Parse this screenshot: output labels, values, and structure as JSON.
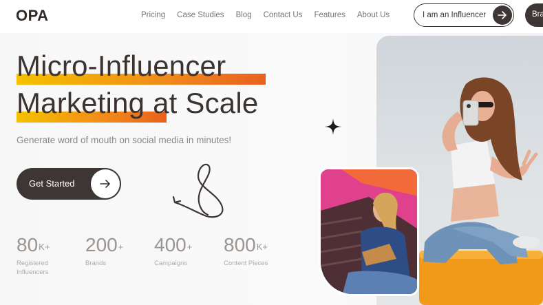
{
  "nav": {
    "logo": "OPA",
    "links": [
      "Pricing",
      "Case Studies",
      "Blog",
      "Contact Us",
      "Features",
      "About Us"
    ],
    "influencer_button": "I am an Influencer",
    "brand_button": "Bra"
  },
  "hero": {
    "title_line1": "Micro-Influencer",
    "title_line2": "Marketing at Scale",
    "subtitle": "Generate word of mouth on social media in minutes!",
    "cta_label": "Get Started"
  },
  "stats": [
    {
      "value": "80",
      "suffix": "K+",
      "label": "Registered Influencers"
    },
    {
      "value": "200",
      "suffix": "+",
      "label": "Brands"
    },
    {
      "value": "400",
      "suffix": "+",
      "label": "Campaigns"
    },
    {
      "value": "800",
      "suffix": "K+",
      "label": "Content Pieces"
    }
  ],
  "icons": {
    "arrow": "arrow-right-icon",
    "sparkle": "sparkle-icon",
    "squiggle": "squiggle-arrow-icon"
  },
  "colors": {
    "dark": "#3e3634",
    "highlight_start": "#f5c100",
    "highlight_end": "#e9601e"
  }
}
